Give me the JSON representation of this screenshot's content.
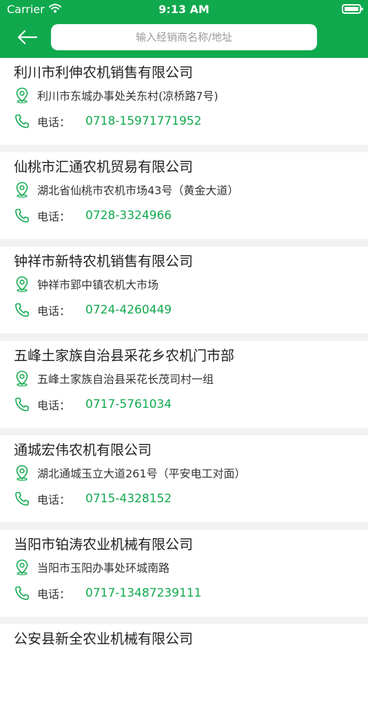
{
  "status": {
    "carrier": "Carrier",
    "time": "9:13 AM"
  },
  "search": {
    "placeholder": "输入经销商名称/地址"
  },
  "phone_label": "电话：",
  "colors": {
    "brand": "#10a94e"
  },
  "dealers": [
    {
      "name": "利川市利伸农机销售有限公司",
      "address": "利川市东城办事处关东村(凉桥路7号)",
      "phone": "0718-15971771952"
    },
    {
      "name": "仙桃市汇通农机贸易有限公司",
      "address": "湖北省仙桃市农机市场43号（黄金大道）",
      "phone": "0728-3324966"
    },
    {
      "name": "钟祥市新特农机销售有限公司",
      "address": "钟祥市郢中镇农机大市场",
      "phone": "0724-4260449"
    },
    {
      "name": "五峰土家族自治县采花乡农机门市部",
      "address": "五峰土家族自治县采花长茂司村一组",
      "phone": "0717-5761034"
    },
    {
      "name": "通城宏伟农机有限公司",
      "address": "湖北通城玉立大道261号（平安电工对面）",
      "phone": "0715-4328152"
    },
    {
      "name": "当阳市铂涛农业机械有限公司",
      "address": "当阳市玉阳办事处环城南路",
      "phone": "0717-13487239111"
    },
    {
      "name": "公安县新全农业机械有限公司"
    }
  ]
}
